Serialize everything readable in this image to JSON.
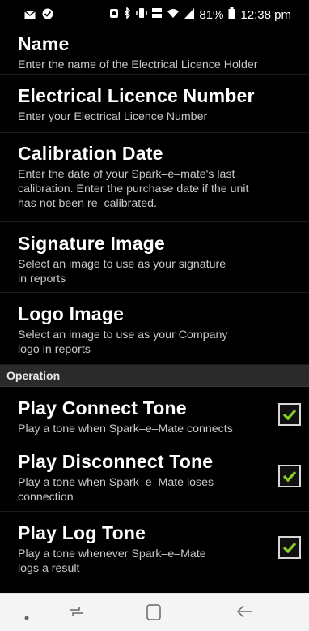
{
  "status": {
    "battery": "81%",
    "time": "12:38 pm"
  },
  "prefs": {
    "name": {
      "title": "Name",
      "summary": "Enter the name of the Electrical Licence Holder"
    },
    "licence": {
      "title": "Electrical Licence Number",
      "summary": "Enter your Electrical Licence Number"
    },
    "calibration": {
      "title": "Calibration Date",
      "summary_lines": [
        "Enter the date of your Spark–e–mate's last",
        "calibration. Enter the purchase date if the unit",
        "has not been re–calibrated."
      ]
    },
    "signature": {
      "title": "Signature Image",
      "summary_lines": [
        "Select an image to use as your signature",
        "in reports"
      ]
    },
    "logo": {
      "title": "Logo Image",
      "summary_lines": [
        "Select an image to use as your Company",
        "logo in reports"
      ]
    }
  },
  "section_operation": "Operation",
  "operation": {
    "connect": {
      "title": "Play Connect Tone",
      "summary": "Play a tone when Spark–e–Mate connects",
      "checked": true
    },
    "disconnect": {
      "title": "Play Disconnect Tone",
      "summary_lines": [
        "Play a tone when Spark–e–Mate loses",
        "connection"
      ],
      "checked": true
    },
    "log": {
      "title": "Play Log Tone",
      "summary_lines": [
        "Play a tone whenever Spark–e–Mate",
        "logs a result"
      ],
      "checked": true
    }
  },
  "colors": {
    "checkmark": "#8ad024",
    "section_bg": "#2a2a2a"
  },
  "icons": [
    "mail-icon",
    "check-circle-icon",
    "alarm-icon",
    "bluetooth-icon",
    "vibrate-icon",
    "volte-icon",
    "wifi-icon",
    "signal-icon",
    "battery-icon",
    "nav-dot-icon",
    "recent-apps-icon",
    "home-icon",
    "back-icon"
  ]
}
